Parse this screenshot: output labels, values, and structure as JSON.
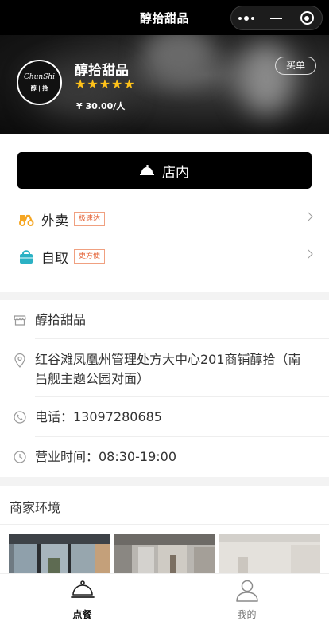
{
  "header": {
    "title": "醇拾甜品",
    "menu_icon": "more-dots-icon",
    "minimize_icon": "minimize-icon",
    "close_icon": "target-close-icon"
  },
  "shop": {
    "logo_text_top": "ChunShi",
    "logo_text_bottom": "醇 | 拾",
    "name": "醇拾甜品",
    "rating_stars": 5,
    "star_glyph": "★",
    "price": "¥ 30.00/人",
    "pay_button": "买单",
    "star_color": "#ffc21a"
  },
  "order_options": {
    "dine_in_label": "店内",
    "items": [
      {
        "label": "外卖",
        "tag": "极速达",
        "icon": "scooter-icon"
      },
      {
        "label": "自取",
        "tag": "更方便",
        "icon": "shopping-bag-icon"
      }
    ],
    "tag_color": "#e5663a"
  },
  "info": {
    "store_name": "醇拾甜品",
    "address": "红谷滩凤凰州管理处方大中心201商铺醇拾（南昌舰主题公园对面）",
    "phone": "电话：13097280685",
    "hours": "营业时间：08:30-19:00"
  },
  "environment": {
    "title": "商家环境",
    "photos": [
      "storefront-glass-photo",
      "interior-photo",
      "wall-photo"
    ]
  },
  "tabbar": {
    "tabs": [
      {
        "label": "点餐",
        "icon": "cloche-icon",
        "active": true
      },
      {
        "label": "我的",
        "icon": "user-icon",
        "active": false
      }
    ]
  }
}
